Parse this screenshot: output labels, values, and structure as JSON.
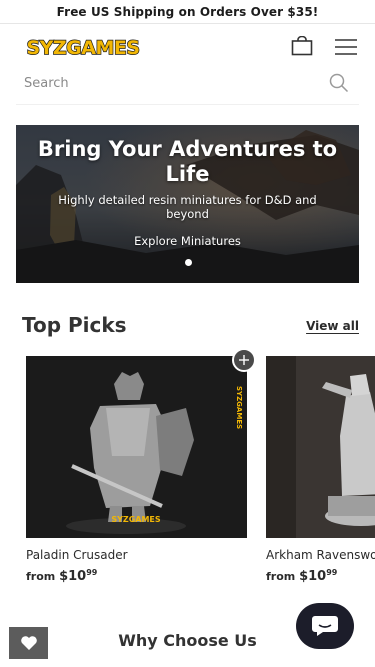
{
  "announcement": {
    "text": "Free US Shipping on Orders Over $35!"
  },
  "header": {
    "logo_text": "SYZGAMES",
    "cart_icon": "shopping-bag-icon",
    "menu_icon": "hamburger-menu-icon"
  },
  "search": {
    "placeholder": "Search",
    "icon": "search-icon"
  },
  "hero": {
    "title": "Bring Your Adventures to Life",
    "subtitle": "Highly detailed resin miniatures for D&D and beyond",
    "link_label": "Explore Miniatures",
    "slide_count": 1,
    "active_slide": 1
  },
  "top_picks": {
    "title": "Top Picks",
    "view_all_label": "View all",
    "products": [
      {
        "name": "Paladin Crusader",
        "price_prefix": "from",
        "price_main": "$10",
        "price_cents": "99",
        "image_watermark": "SYZGAMES"
      },
      {
        "name": "Arkham Ravenswood",
        "price_prefix": "from",
        "price_main": "$10",
        "price_cents": "99"
      }
    ]
  },
  "why_section": {
    "title": "Why Choose Us"
  },
  "floating": {
    "wishlist_icon": "heart-icon",
    "chat_icon": "chat-bubble-icon"
  },
  "colors": {
    "accent_logo": "#f2b705",
    "dark_button": "#4a4a4a",
    "chat_button": "#1c1d2a"
  }
}
